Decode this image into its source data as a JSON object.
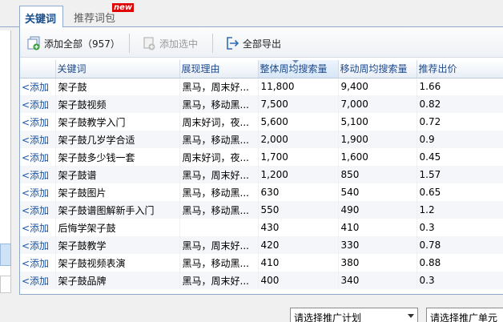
{
  "tabs": [
    {
      "label": "关键词"
    },
    {
      "label": "推荐词包"
    }
  ],
  "badge": "new",
  "toolbar": {
    "add_all_label": "添加全部（957）",
    "add_selected_label": "添加选中",
    "export_all_label": "全部导出"
  },
  "columns": [
    "关键词",
    "展现理由",
    "整体周均搜索量",
    "移动周均搜索量",
    "推荐出价"
  ],
  "row_action": "<添加",
  "rows": [
    {
      "keyword": "架子鼓",
      "reason": "黑马，周末好...",
      "overall": "11,800",
      "mobile": "9,400",
      "bid": "1.66"
    },
    {
      "keyword": "架子鼓视频",
      "reason": "黑马，移动黑...",
      "overall": "7,500",
      "mobile": "7,000",
      "bid": "0.82"
    },
    {
      "keyword": "架子鼓教学入门",
      "reason": "周末好词，夜...",
      "overall": "5,600",
      "mobile": "5,100",
      "bid": "0.72"
    },
    {
      "keyword": "架子鼓几岁学合适",
      "reason": "黑马，移动黑...",
      "overall": "2,000",
      "mobile": "1,900",
      "bid": "0.9"
    },
    {
      "keyword": "架子鼓多少钱一套",
      "reason": "周末好词，夜...",
      "overall": "1,700",
      "mobile": "1,600",
      "bid": "0.45"
    },
    {
      "keyword": "架子鼓谱",
      "reason": "黑马，周末好...",
      "overall": "1,200",
      "mobile": "850",
      "bid": "1.57"
    },
    {
      "keyword": "架子鼓图片",
      "reason": "黑马，移动黑...",
      "overall": "630",
      "mobile": "540",
      "bid": "0.65"
    },
    {
      "keyword": "架子鼓谱图解新手入门",
      "reason": "黑马，移动黑...",
      "overall": "550",
      "mobile": "490",
      "bid": "1.2"
    },
    {
      "keyword": "后悔学架子鼓",
      "reason": "",
      "overall": "430",
      "mobile": "410",
      "bid": "0.3"
    },
    {
      "keyword": "架子鼓教学",
      "reason": "黑马，周末好...",
      "overall": "420",
      "mobile": "330",
      "bid": "0.78"
    },
    {
      "keyword": "架子鼓视频表演",
      "reason": "黑马，移动黑...",
      "overall": "410",
      "mobile": "380",
      "bid": "0.88"
    },
    {
      "keyword": "架子鼓品牌",
      "reason": "黑马，周末好...",
      "overall": "400",
      "mobile": "340",
      "bid": "0.3"
    }
  ],
  "bottom": {
    "plan_select": "请选择推广计划",
    "unit_select": "请选择推广单元"
  },
  "icons": {
    "add_all": "add-all-icon",
    "add_selected": "add-selected-icon",
    "export": "export-icon"
  },
  "colors": {
    "accent": "#1a55a6",
    "badge": "#e00000"
  }
}
